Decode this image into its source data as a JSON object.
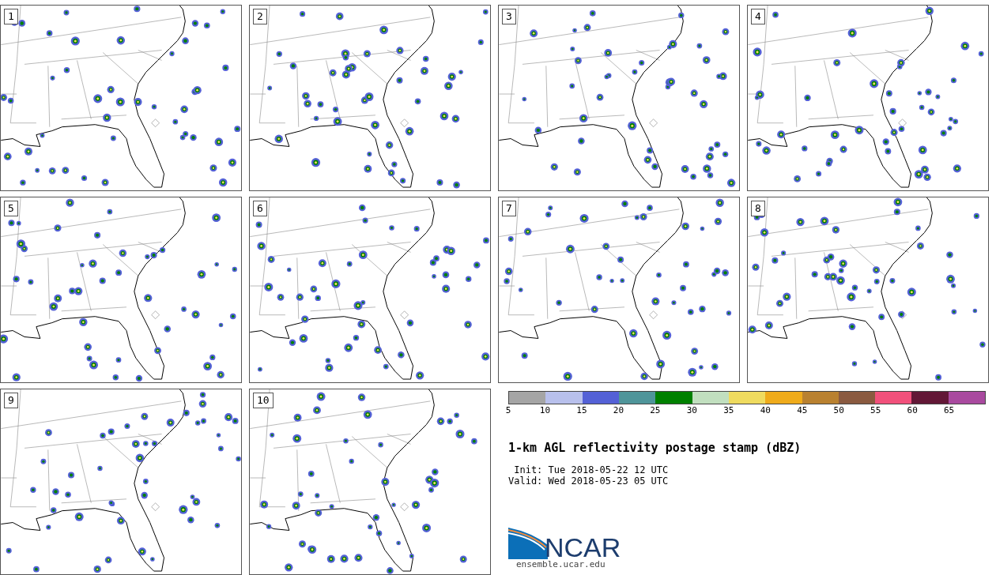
{
  "panels": [
    {
      "label": "1"
    },
    {
      "label": "2"
    },
    {
      "label": "3"
    },
    {
      "label": "4"
    },
    {
      "label": "5"
    },
    {
      "label": "6"
    },
    {
      "label": "7"
    },
    {
      "label": "8"
    },
    {
      "label": "9"
    },
    {
      "label": "10"
    }
  ],
  "colorbar": [
    {
      "label": "5",
      "color": "#a5a5a5"
    },
    {
      "label": "10",
      "color": "#b8c0ec"
    },
    {
      "label": "15",
      "color": "#5461d6"
    },
    {
      "label": "20",
      "color": "#4f959a"
    },
    {
      "label": "25",
      "color": "#008000"
    },
    {
      "label": "30",
      "color": "#c1dfbf"
    },
    {
      "label": "35",
      "color": "#efdb5f"
    },
    {
      "label": "40",
      "color": "#efab1b"
    },
    {
      "label": "45",
      "color": "#b98130"
    },
    {
      "label": "50",
      "color": "#8a5a40"
    },
    {
      "label": "55",
      "color": "#f1507b"
    },
    {
      "label": "60",
      "color": "#621736"
    },
    {
      "label": "65",
      "color": "#a94a9f"
    }
  ],
  "title": "1-km AGL reflectivity postage stamp (dBZ)",
  "init": " Init: Tue 2018-05-22 12 UTC",
  "valid": "Valid: Wed 2018-05-23 05 UTC",
  "logo": {
    "text": "NCAR"
  },
  "url": "ensemble.ucar.edu"
}
